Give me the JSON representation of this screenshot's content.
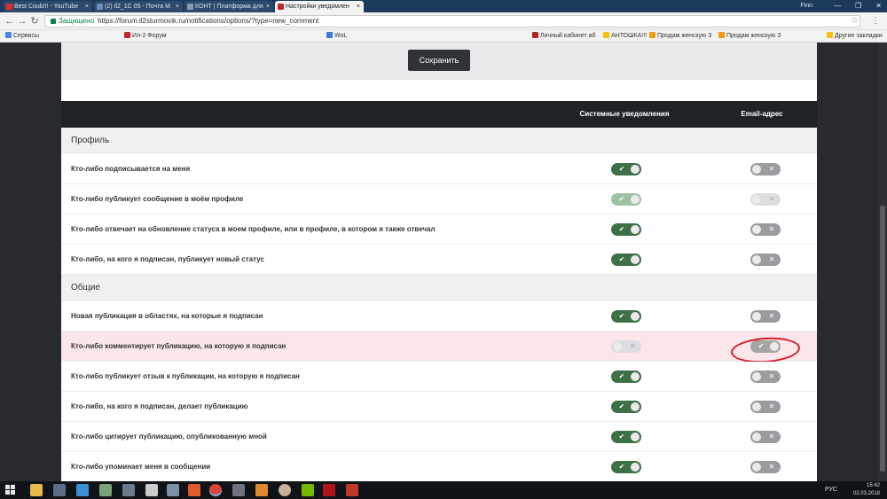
{
  "browser": {
    "tabs": [
      {
        "title": "Best Coub!!! - YouTube",
        "color": "#e52d27",
        "active": false
      },
      {
        "title": "(2) Il2_1C 05 - Почта M",
        "color": "#6c8ebf",
        "active": false
      },
      {
        "title": "КОНТ | Платформа для",
        "color": "#8b9bb0",
        "active": false
      },
      {
        "title": "Настройки уведомлен",
        "color": "#c0272d",
        "active": true
      }
    ],
    "user": "Finn",
    "secure_label": "Защищено",
    "url": "https://forum.il2sturmovik.ru/notifications/options/?type=new_comment",
    "bookmarks": [
      {
        "label": "Сервисы",
        "color": "#4a86e8"
      },
      {
        "label": "Ил-2 Форум",
        "color": "#c0272d"
      },
      {
        "label": "WoL",
        "color": "#3a7bd5"
      },
      {
        "label": "Личный кабинет аб",
        "color": "#b22222"
      },
      {
        "label": "АНТОШКА!!!",
        "color": "#f4c20d"
      },
      {
        "label": "Продам женскую З",
        "color": "#f39c12"
      },
      {
        "label": "Продам женскую З",
        "color": "#f39c12"
      },
      {
        "label": "Другие закладки",
        "color": "#f4c20d"
      }
    ]
  },
  "page": {
    "save_label": "Сохранить",
    "col_system": "Системные уведомления",
    "col_email": "Email-адрес",
    "sections": [
      {
        "title": "Профиль",
        "rows": [
          {
            "label": "Кто-либо подписывается на меня",
            "system": "on",
            "email": "off"
          },
          {
            "label": "Кто-либо публикует сообщение в моём профиле",
            "system": "on-faded",
            "email": "off-faded"
          },
          {
            "label": "Кто-либо отвечает на обновление статуса в моем профиле, или в профиле, в котором я также отвечал",
            "system": "on",
            "email": "off"
          },
          {
            "label": "Кто-либо, на кого я подписан, публикует новый статус",
            "system": "on",
            "email": "off"
          }
        ]
      },
      {
        "title": "Общие",
        "rows": [
          {
            "label": "Новая публикация в областях, на которые я подписан",
            "system": "on",
            "email": "off"
          },
          {
            "label": "Кто-либо комментирует публикацию, на которую я подписан",
            "system": "off-faded",
            "email": "on-grey",
            "highlighted": true
          },
          {
            "label": "Кто-либо публикует отзыв к публикации, на которую я подписан",
            "system": "on",
            "email": "off"
          },
          {
            "label": "Кто-либо, на кого я подписан, делает публикацию",
            "system": "on",
            "email": "off"
          },
          {
            "label": "Кто-либо цитирует публикацию, опубликованную мной",
            "system": "on",
            "email": "off"
          },
          {
            "label": "Кто-либо упоминает меня в сообщении",
            "system": "on",
            "email": "off"
          }
        ]
      }
    ]
  },
  "taskbar": {
    "lang": "РУС",
    "time": "15:42",
    "date": "02.03.2018"
  }
}
